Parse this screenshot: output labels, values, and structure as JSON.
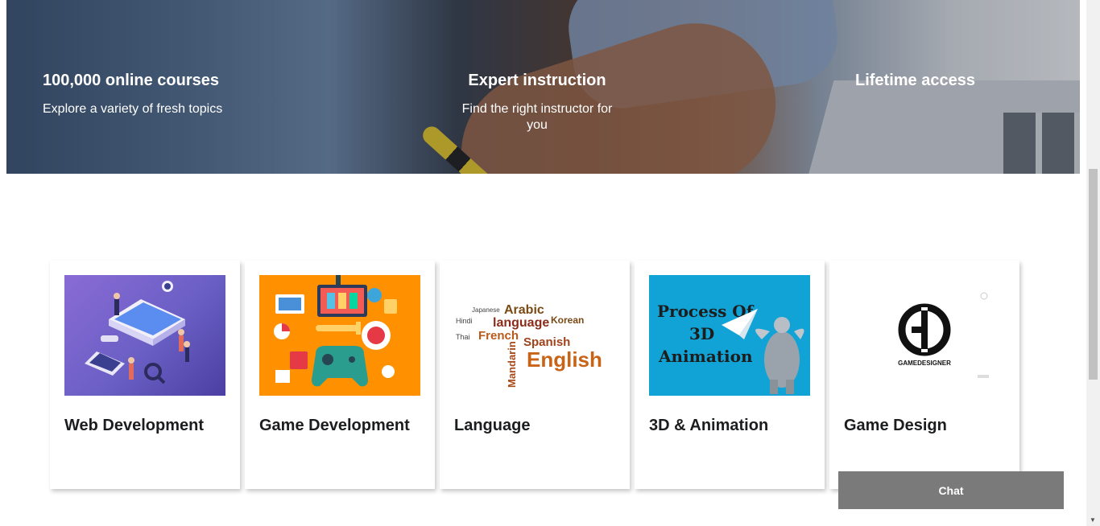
{
  "hero": {
    "features": [
      {
        "title": "100,000 online courses",
        "subtitle": "Explore a variety of fresh topics"
      },
      {
        "title": "Expert instruction",
        "subtitle": "Find the right instructor for you"
      },
      {
        "title": "Lifetime access",
        "subtitle": ""
      }
    ]
  },
  "categories": [
    {
      "label": "Web Development"
    },
    {
      "label": "Game Development"
    },
    {
      "label": "Language"
    },
    {
      "label": "3D & Animation"
    },
    {
      "label": "Game Design"
    }
  ],
  "thumbs": {
    "language_words": {
      "arabic": "Arabic",
      "language": "language",
      "french": "French",
      "spanish": "Spanish",
      "english": "English",
      "mandarin": "Mandarin",
      "hindi": "Hindi",
      "japanese": "Japanese",
      "korean": "Korean",
      "thai": "Thai"
    },
    "animation": {
      "line1": "Process Of",
      "line2": "3D",
      "line3": "Animation"
    },
    "gamedesigner": "GAMEDESIGNER"
  },
  "chat": {
    "label": "Chat"
  },
  "colors": {
    "card_title": "#1c1d1f",
    "chat_bg": "#7a7a7a",
    "game_thumb_bg": "#ff9100",
    "anim_thumb_bg": "#11a2d6"
  }
}
